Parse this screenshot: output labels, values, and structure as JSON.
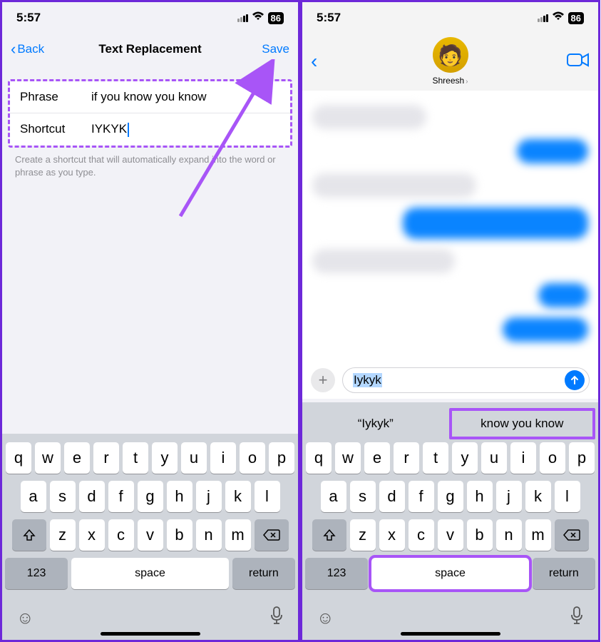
{
  "status": {
    "time": "5:57",
    "battery": "86"
  },
  "left": {
    "nav_back": "Back",
    "nav_title": "Text Replacement",
    "nav_save": "Save",
    "form": {
      "phrase_label": "Phrase",
      "phrase_value": "if you know you know",
      "shortcut_label": "Shortcut",
      "shortcut_value": "IYKYK"
    },
    "help": "Create a shortcut that will automatically expand into the word or phrase as you type."
  },
  "right": {
    "contact_name": "Shreesh",
    "input_value": "Iykyk",
    "suggestions": {
      "left": "“Iykyk”",
      "right": "know you know"
    }
  },
  "keyboard": {
    "row1": [
      "q",
      "w",
      "e",
      "r",
      "t",
      "y",
      "u",
      "i",
      "o",
      "p"
    ],
    "row2": [
      "a",
      "s",
      "d",
      "f",
      "g",
      "h",
      "j",
      "k",
      "l"
    ],
    "row3": [
      "z",
      "x",
      "c",
      "v",
      "b",
      "n",
      "m"
    ],
    "numeric": "123",
    "space": "space",
    "return": "return"
  }
}
